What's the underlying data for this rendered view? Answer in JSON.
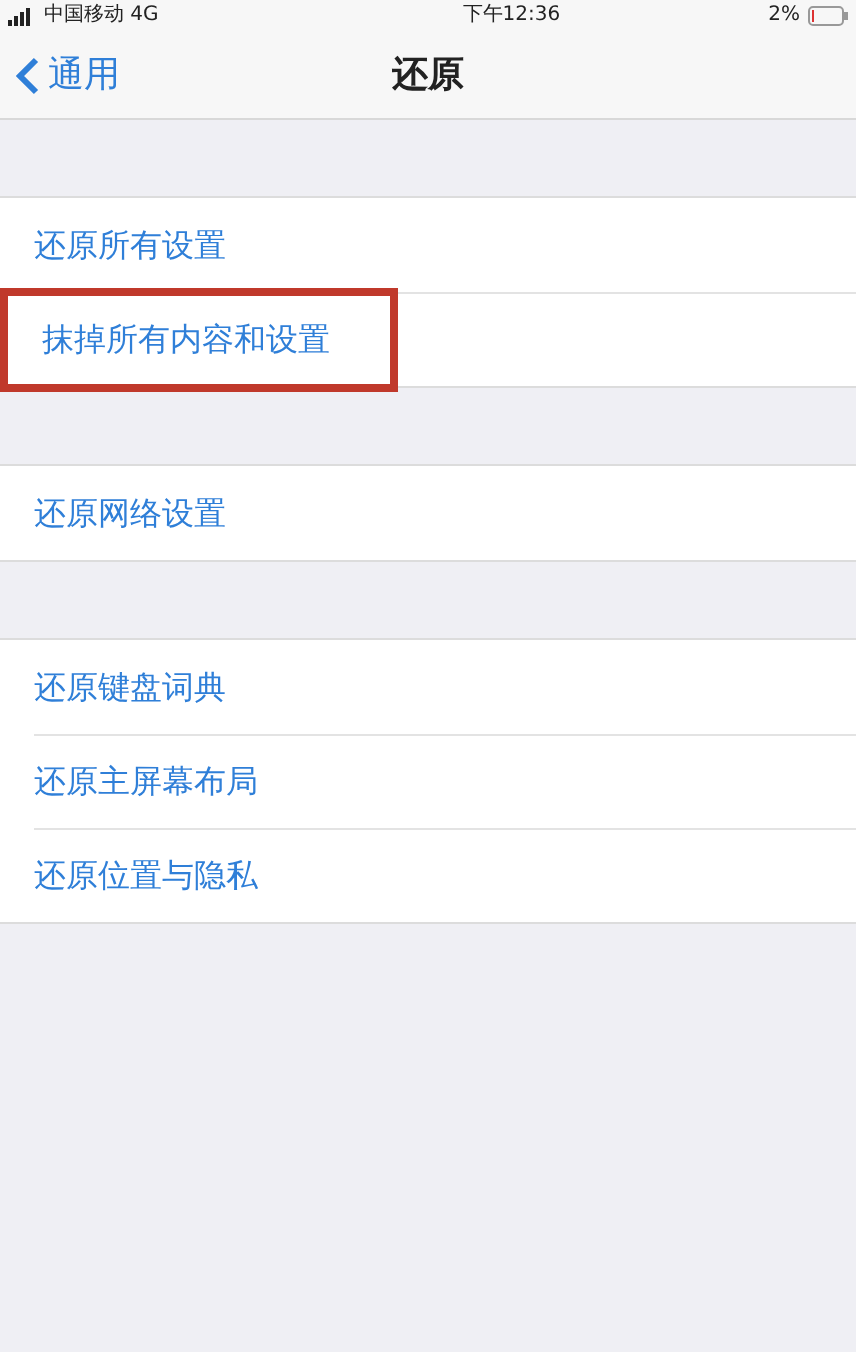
{
  "status_bar": {
    "carrier": "中国移动 4G",
    "time": "下午12:36",
    "battery": "2%"
  },
  "nav": {
    "back": "通用",
    "title": "还原"
  },
  "groups": [
    {
      "items": [
        {
          "label": "还原所有设置",
          "highlighted": false
        },
        {
          "label": "抹掉所有内容和设置",
          "highlighted": true
        }
      ]
    },
    {
      "items": [
        {
          "label": "还原网络设置",
          "highlighted": false
        }
      ]
    },
    {
      "items": [
        {
          "label": "还原键盘词典",
          "highlighted": false
        },
        {
          "label": "还原主屏幕布局",
          "highlighted": false
        },
        {
          "label": "还原位置与隐私",
          "highlighted": false
        }
      ]
    }
  ]
}
